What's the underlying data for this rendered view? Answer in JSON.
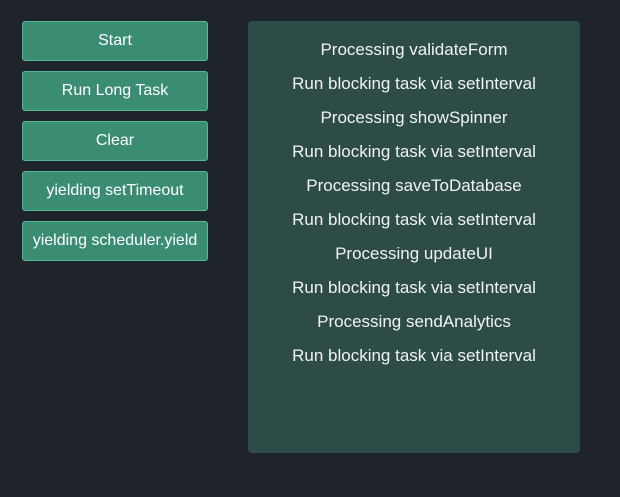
{
  "controls": {
    "start_label": "Start",
    "run_long_task_label": "Run Long Task",
    "clear_label": "Clear",
    "yield_settimeout_label": "yielding setTimeout",
    "yield_scheduler_label": "yielding scheduler.yield"
  },
  "log": {
    "lines": [
      "Processing validateForm",
      "Run blocking task via setInterval",
      "Processing showSpinner",
      "Run blocking task via setInterval",
      "Processing saveToDatabase",
      "Run blocking task via setInterval",
      "Processing updateUI",
      "Run blocking task via setInterval",
      "Processing sendAnalytics",
      "Run blocking task via setInterval"
    ]
  },
  "colors": {
    "background": "#1f242c",
    "button": "#3a8d72",
    "button_border": "#56b895",
    "panel": "#2d4b47",
    "text": "#f0f4f2"
  }
}
